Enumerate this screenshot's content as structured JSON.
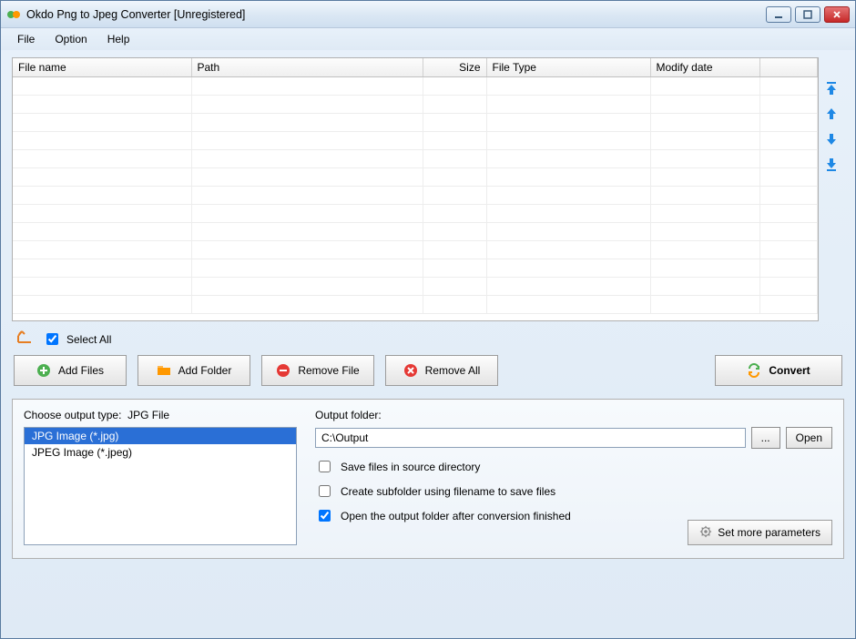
{
  "window": {
    "title": "Okdo Png to Jpeg Converter [Unregistered]"
  },
  "menu": {
    "file": "File",
    "option": "Option",
    "help": "Help"
  },
  "table": {
    "headers": {
      "filename": "File name",
      "path": "Path",
      "size": "Size",
      "filetype": "File Type",
      "modify": "Modify date"
    }
  },
  "select_all": {
    "label": "Select All",
    "checked": true
  },
  "buttons": {
    "add_files": "Add Files",
    "add_folder": "Add Folder",
    "remove_file": "Remove File",
    "remove_all": "Remove All",
    "convert": "Convert"
  },
  "output_type": {
    "label": "Choose output type:",
    "current": "JPG File",
    "options": [
      {
        "text": "JPG Image (*.jpg)",
        "selected": true
      },
      {
        "text": "JPEG Image (*.jpeg)",
        "selected": false
      }
    ]
  },
  "output_folder": {
    "label": "Output folder:",
    "path": "C:\\Output",
    "browse": "...",
    "open": "Open"
  },
  "options": {
    "save_source": {
      "label": "Save files in source directory",
      "checked": false
    },
    "create_subfolder": {
      "label": "Create subfolder using filename to save files",
      "checked": false
    },
    "open_after": {
      "label": "Open the output folder after conversion finished",
      "checked": true
    }
  },
  "params_button": "Set more parameters"
}
